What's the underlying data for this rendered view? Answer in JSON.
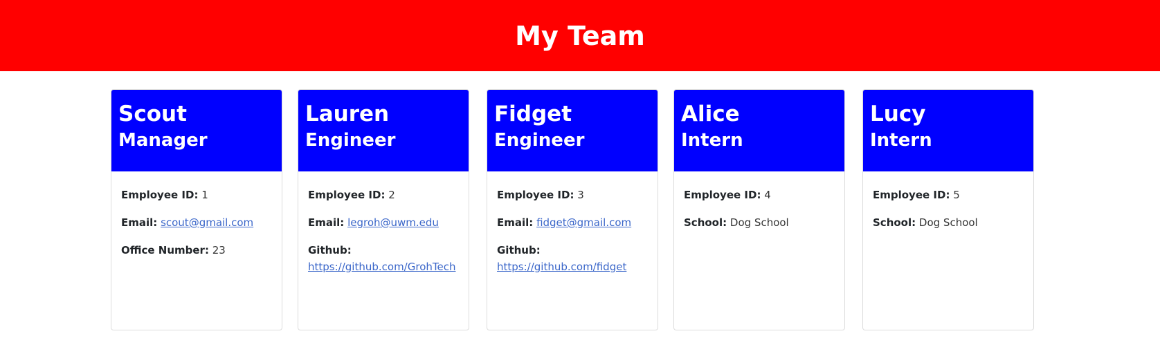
{
  "header": {
    "title": "My Team"
  },
  "labels": {
    "id": "Employee ID:",
    "email": "Email:",
    "office": "Office Number:",
    "github": "Github:",
    "school": "School:"
  },
  "cards": [
    {
      "name": "Scout",
      "role": "Manager",
      "id": "1",
      "email": "scout@gmail.com",
      "office": "23"
    },
    {
      "name": "Lauren",
      "role": "Engineer",
      "id": "2",
      "email": "legroh@uwm.edu",
      "github": "https://github.com/GrohTech"
    },
    {
      "name": "Fidget",
      "role": "Engineer",
      "id": "3",
      "email": "fidget@gmail.com",
      "github": "https://github.com/fidget"
    },
    {
      "name": "Alice",
      "role": "Intern",
      "id": "4",
      "school": "Dog School"
    },
    {
      "name": "Lucy",
      "role": "Intern",
      "id": "5",
      "school": "Dog School"
    }
  ],
  "colors": {
    "banner": "#ff0000",
    "card_header": "#0000ff",
    "link": "#3a66c9"
  }
}
